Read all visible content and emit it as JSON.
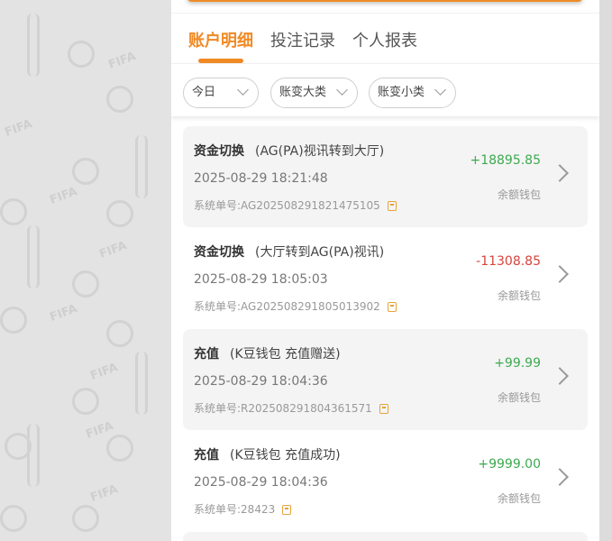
{
  "tabs": [
    {
      "label": "账户明细",
      "active": true
    },
    {
      "label": "投注记录",
      "active": false
    },
    {
      "label": "个人报表",
      "active": false
    }
  ],
  "filters": [
    {
      "label": "今日"
    },
    {
      "label": "账变大类"
    },
    {
      "label": "账变小类"
    }
  ],
  "colors": {
    "accent": "#f08a24",
    "positive": "#3daa4f",
    "negative": "#d9433a"
  },
  "transactions": [
    {
      "type": "资金切换",
      "detail": "(AG(PA)视讯转到大厅)",
      "time": "2025-08-29 18:21:48",
      "serial_label": "系统单号:",
      "serial": "AG202508291821475105",
      "amount": "+18895.85",
      "wallet": "余额钱包"
    },
    {
      "type": "资金切换",
      "detail": "(大厅转到AG(PA)视讯)",
      "time": "2025-08-29 18:05:03",
      "serial_label": "系统单号:",
      "serial": "AG202508291805013902",
      "amount": "-11308.85",
      "wallet": "余额钱包"
    },
    {
      "type": "充值",
      "detail": "(K豆钱包 充值赠送)",
      "time": "2025-08-29 18:04:36",
      "serial_label": "系统单号:",
      "serial": "R202508291804361571",
      "amount": "+99.99",
      "wallet": "余额钱包"
    },
    {
      "type": "充值",
      "detail": "(K豆钱包 充值成功)",
      "time": "2025-08-29 18:04:36",
      "serial_label": "系统单号:",
      "serial": "28423",
      "amount": "+9999.00",
      "wallet": "余额钱包"
    }
  ]
}
